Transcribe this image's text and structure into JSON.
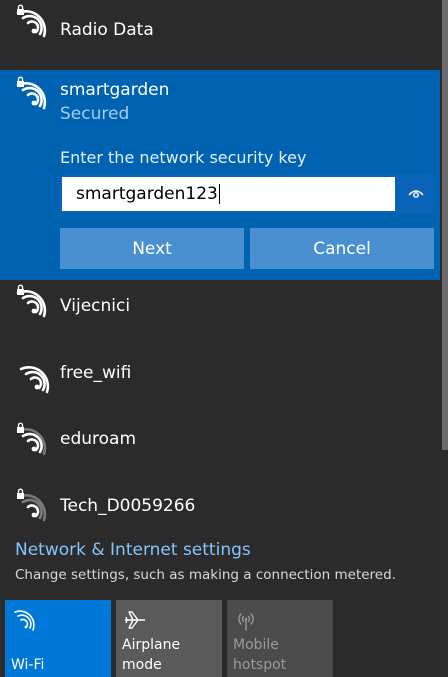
{
  "networks": [
    {
      "name": "Radio Data",
      "secured": true
    },
    {
      "name": "Vijecnici",
      "secured": true
    },
    {
      "name": "free_wifi",
      "secured": false
    },
    {
      "name": "eduroam",
      "secured": true
    },
    {
      "name": "Tech_D0059266",
      "secured": true
    }
  ],
  "selected": {
    "name": "smartgarden",
    "status": "Secured",
    "key_label": "Enter the network security key",
    "key_value": "smartgarden123",
    "next_label": "Next",
    "cancel_label": "Cancel"
  },
  "settings": {
    "link": "Network & Internet settings",
    "description": "Change settings, such as making a connection metered."
  },
  "quick_actions": {
    "wifi": "Wi-Fi",
    "airplane": "Airplane mode",
    "hotspot": "Mobile hotspot"
  },
  "colors": {
    "panel": "#2b2b2b",
    "selected": "#0063b1",
    "accent": "#0078d7",
    "link": "#86c4ff"
  }
}
